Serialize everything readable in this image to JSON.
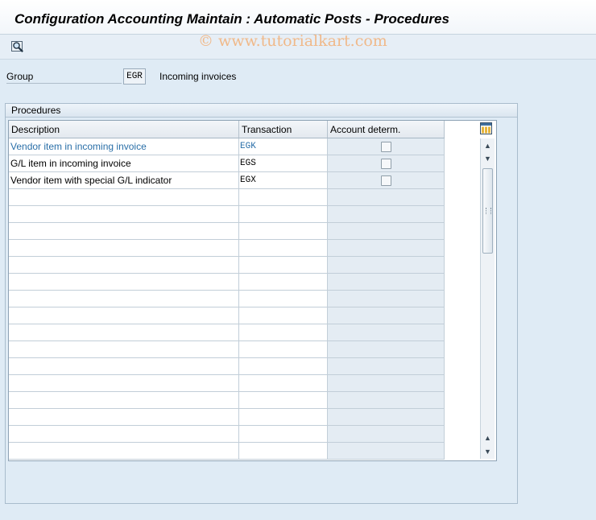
{
  "window": {
    "title": "Configuration Accounting Maintain : Automatic Posts - Procedures",
    "watermark": "© www.tutorialkart.com"
  },
  "toolbar": {
    "icons": [
      "find-icon"
    ]
  },
  "group": {
    "label": "Group",
    "value": "EGR",
    "description": "Incoming invoices"
  },
  "procedures": {
    "title": "Procedures",
    "columns": [
      "Description",
      "Transaction",
      "Account determ."
    ],
    "rows": [
      {
        "description": "Vendor item in incoming invoice",
        "transaction": "EGK",
        "account_determ": false
      },
      {
        "description": "G/L item in incoming invoice",
        "transaction": "EGS",
        "account_determ": false
      },
      {
        "description": "Vendor item with special G/L indicator",
        "transaction": "EGX",
        "account_determ": false
      }
    ]
  },
  "colors": {
    "background": "#dfebf5",
    "link_text": "#2a6fa8",
    "watermark": "#f0b98a"
  }
}
